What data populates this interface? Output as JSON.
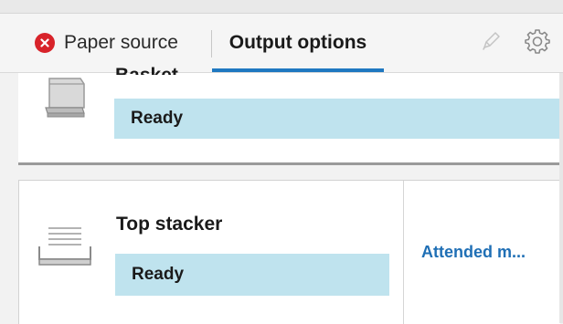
{
  "tabs": {
    "paper_source": {
      "label": "Paper source",
      "status_icon": "error-circle-icon",
      "status_color": "#d8232a"
    },
    "output_options": {
      "label": "Output options",
      "selected": true,
      "underline_color": "#1f78c1"
    }
  },
  "toolbar": {
    "edit_icon": "pen-icon",
    "settings_icon": "gear-icon"
  },
  "outputs": [
    {
      "name": "Basket",
      "status": "Ready",
      "icon": "basket-icon"
    },
    {
      "name": "Top stacker",
      "status": "Ready",
      "icon": "stacker-icon",
      "action_label": "Attended m..."
    }
  ],
  "colors": {
    "status_bg": "#bfe3ee",
    "link": "#1f6fb5"
  }
}
